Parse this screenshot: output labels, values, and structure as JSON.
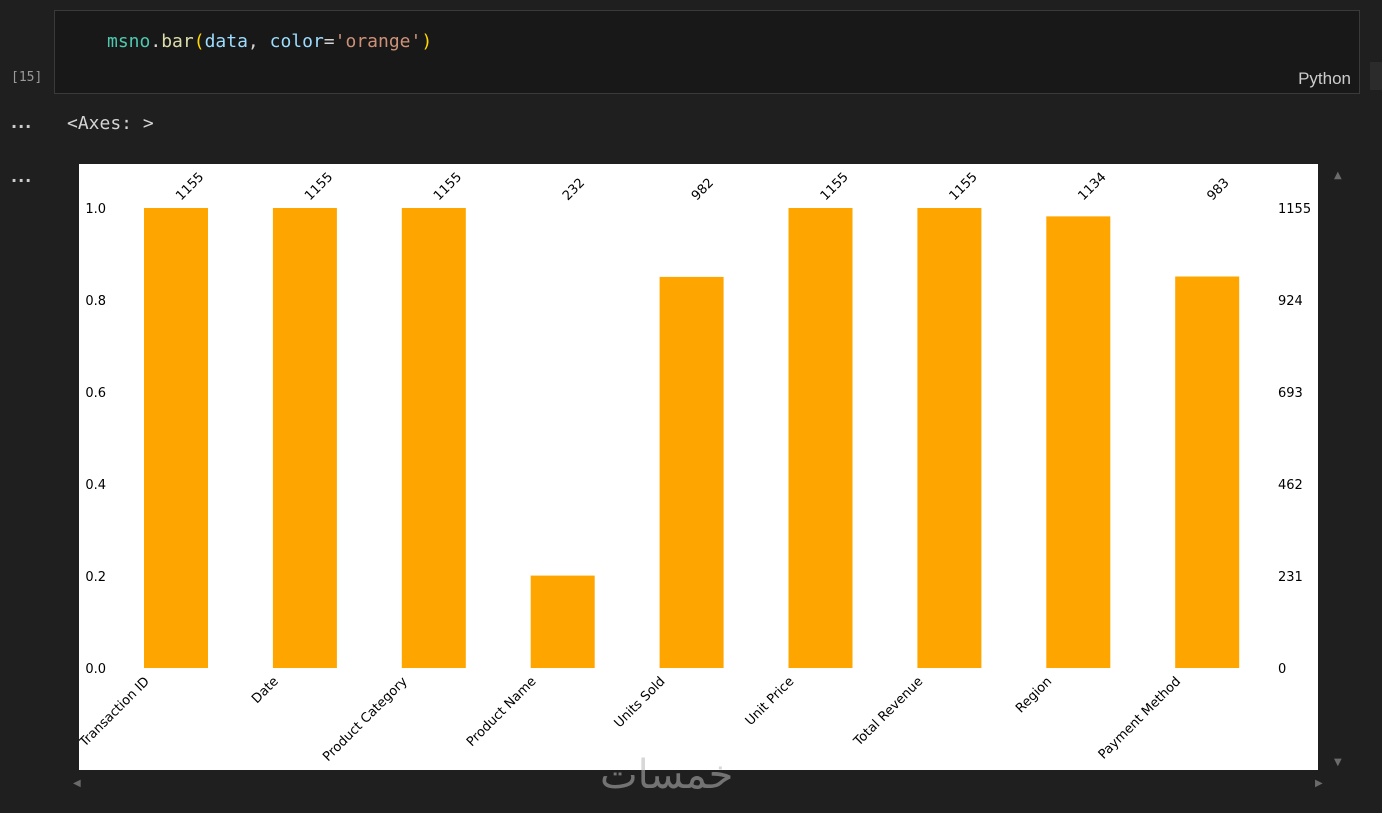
{
  "cell": {
    "execution_count": "[15]",
    "code_tokens": [
      {
        "t": "msno",
        "c": "tk-obj"
      },
      {
        "t": ".",
        "c": "tk-op"
      },
      {
        "t": "bar",
        "c": "tk-fn"
      },
      {
        "t": "(",
        "c": "tk-paren"
      },
      {
        "t": "data",
        "c": "tk-var"
      },
      {
        "t": ", ",
        "c": "tk-op"
      },
      {
        "t": "color",
        "c": "tk-var"
      },
      {
        "t": "=",
        "c": "tk-op"
      },
      {
        "t": "'orange'",
        "c": "tk-str"
      },
      {
        "t": ")",
        "c": "tk-paren"
      }
    ],
    "language": "Python"
  },
  "output": {
    "more_label": "...",
    "axes_repr": "<Axes: >"
  },
  "watermark": "خمسات",
  "colors": {
    "bar": "#ffa500",
    "background": "#1f1f1f",
    "code_background": "#181818"
  },
  "chart_data": {
    "type": "bar",
    "categories": [
      "Transaction ID",
      "Date",
      "Product Category",
      "Product Name",
      "Units Sold",
      "Unit Price",
      "Total Revenue",
      "Region",
      "Payment Method"
    ],
    "values": [
      1155,
      1155,
      1155,
      232,
      982,
      1155,
      1155,
      1134,
      983
    ],
    "bar_labels": [
      "1155",
      "1155",
      "1155",
      "232",
      "982",
      "1155",
      "1155",
      "1134",
      "983"
    ],
    "ylim": [
      0,
      1.0
    ],
    "left_ticks": [
      "0.0",
      "0.2",
      "0.4",
      "0.6",
      "0.8",
      "1.0"
    ],
    "right_ticks": [
      "0",
      "231",
      "462",
      "693",
      "924",
      "1155"
    ],
    "total_rows": 1155,
    "grid": false
  }
}
